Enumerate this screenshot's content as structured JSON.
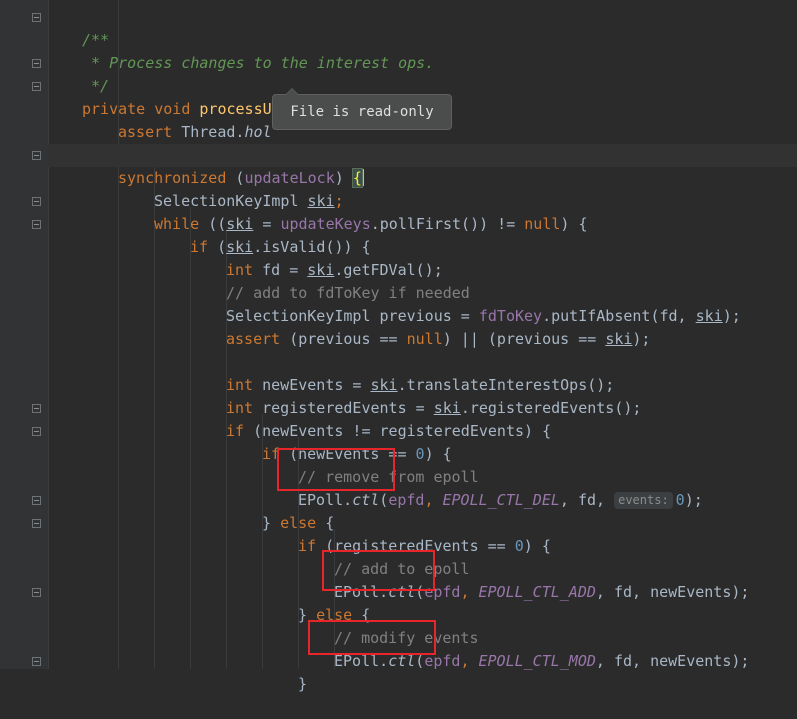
{
  "tooltip": {
    "text": "File is read-only"
  },
  "code": {
    "l1": "/**",
    "l2": " * Process changes to the interest ops.",
    "l3": " */",
    "l4": {
      "kw": "private void ",
      "fn": "processUpdateQueue",
      "rest": "() {"
    },
    "l5": {
      "kw": "assert ",
      "a": "Thread.",
      "b": "hol"
    },
    "l7": {
      "kw": "synchronized ",
      "a": "(",
      "f": "updateLock",
      "b": ") ",
      "brace": "{"
    },
    "l8": {
      "a": "SelectionKeyImpl ",
      "v": "ski",
      "b": ";"
    },
    "l9": {
      "kw": "while ",
      "a": "((",
      "v": "ski",
      "b": " = ",
      "f": "updateKeys",
      "c": ".pollFirst()) != ",
      "nl": "null",
      "d": ") {"
    },
    "l10": {
      "kw": "if ",
      "a": "(",
      "v": "ski",
      "b": ".isValid()) {"
    },
    "l11": {
      "kw": "int ",
      "a": "fd = ",
      "v": "ski",
      "b": ".getFDVal();"
    },
    "l12": "// add to fdToKey if needed",
    "l13": {
      "a": "SelectionKeyImpl previous = ",
      "f": "fdToKey",
      "b": ".putIfAbsent(fd, ",
      "v": "ski",
      "c": ");"
    },
    "l14": {
      "kw": "assert ",
      "a": "(previous == ",
      "nl": "null",
      "b": ") || (previous == ",
      "v": "ski",
      "c": ");"
    },
    "l16": {
      "kw": "int ",
      "a": "newEvents = ",
      "v": "ski",
      "b": ".translateInterestOps();"
    },
    "l17": {
      "kw": "int ",
      "a": "registeredEvents = ",
      "v": "ski",
      "b": ".registeredEvents();"
    },
    "l18": {
      "kw": "if ",
      "a": "(newEvents != registeredEvents) {"
    },
    "l19": {
      "kw": "if ",
      "a": "(newEvents == ",
      "n": "0",
      "b": ") {"
    },
    "l20": "// remove from epoll",
    "l21": {
      "a": "EPoll.",
      "m": "ctl",
      "b": "(",
      "f": "epfd",
      "c": ", ",
      "k": "EPOLL_CTL_DEL",
      "d": ", fd, ",
      "hint": "events:",
      "n": "0",
      "e": ");"
    },
    "l22": {
      "a": "} ",
      "kw": "else",
      "b": " {"
    },
    "l23": {
      "kw": "if ",
      "a": "(registeredEvents == ",
      "n": "0",
      "b": ") {"
    },
    "l24": "// add to epoll",
    "l25": {
      "a": "EPoll.",
      "m": "ctl",
      "b": "(",
      "f": "epfd",
      "c": ", ",
      "k": "EPOLL_CTL_ADD",
      "d": ", fd, newEvents);"
    },
    "l26": {
      "a": "} ",
      "kw": "else",
      "b": " {"
    },
    "l27": "// modify events",
    "l28": {
      "a": "EPoll.",
      "m": "ctl",
      "b": "(",
      "f": "epfd",
      "c": ", ",
      "k": "EPOLL_CTL_MOD",
      "d": ", fd, newEvents);"
    },
    "l29": "}"
  },
  "colors": {
    "background": "#2b2b2b",
    "keyword": "#cc7832",
    "method": "#ffc66d",
    "field": "#9876aa",
    "comment": "#808080",
    "doc_comment": "#629755",
    "number": "#6897bb",
    "highlight_box": "#e8252b"
  }
}
